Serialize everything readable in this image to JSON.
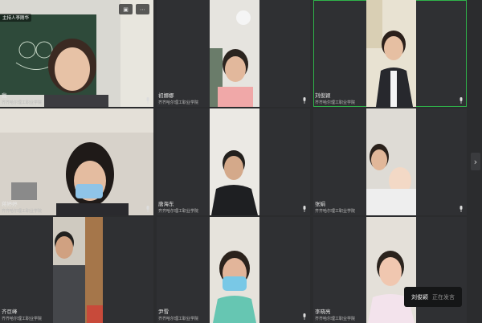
{
  "host_tag": "主持人李刚华",
  "participants": [
    {
      "name": "我",
      "school": "齐齐哈尔理工职业学院",
      "has_video": true
    },
    {
      "name": "初娜娜",
      "school": "齐齐哈尔理工职业学院",
      "has_video": true
    },
    {
      "name": "刘俊颖",
      "school": "齐齐哈尔理工职业学院",
      "has_video": true
    },
    {
      "name": "蒋婷婷",
      "school": "齐齐哈尔理工职业学院",
      "has_video": true
    },
    {
      "name": "唐海东",
      "school": "齐齐哈尔理工职业学院",
      "has_video": true
    },
    {
      "name": "张娟",
      "school": "齐齐哈尔理工职业学院",
      "has_video": true
    },
    {
      "name": "齐巨峰",
      "school": "齐齐哈尔理工职业学院",
      "has_video": true
    },
    {
      "name": "尹雪",
      "school": "齐齐哈尔理工职业学院",
      "has_video": true
    },
    {
      "name": "李晓亮",
      "school": "齐齐哈尔理工职业学院",
      "has_video": true
    }
  ],
  "speaking": {
    "name": "刘俊颖",
    "status": "正在发言"
  },
  "icons": {
    "mic": "mic-icon",
    "menu": "more-icon",
    "pin": "pin-icon",
    "arrow": "chevron-right-icon"
  },
  "colors": {
    "active_speaker_border": "#2fb34a",
    "background": "#2b2c2e"
  }
}
